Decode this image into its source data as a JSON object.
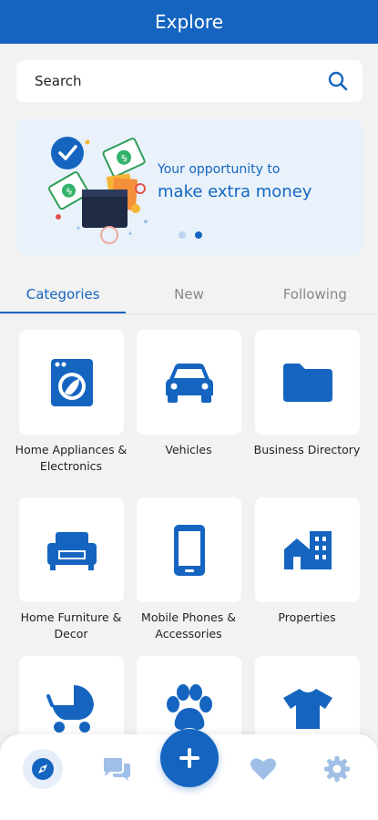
{
  "header": {
    "title": "Explore"
  },
  "search": {
    "placeholder": "Search"
  },
  "banner": {
    "line1": "Your opportunity to",
    "line2": "make extra money"
  },
  "tabs": [
    {
      "label": "Categories",
      "active": true
    },
    {
      "label": "New",
      "active": false
    },
    {
      "label": "Following",
      "active": false
    }
  ],
  "categories": [
    {
      "label": "Home Appliances & Electronics",
      "icon": "washing-machine-icon"
    },
    {
      "label": "Vehicles",
      "icon": "car-icon"
    },
    {
      "label": "Business Directory",
      "icon": "folder-icon"
    },
    {
      "label": "Home Furniture & Decor",
      "icon": "sofa-icon"
    },
    {
      "label": "Mobile Phones & Accessories",
      "icon": "smartphone-icon"
    },
    {
      "label": "Properties",
      "icon": "buildings-icon"
    },
    {
      "label": "",
      "icon": "stroller-icon"
    },
    {
      "label": "",
      "icon": "paw-icon"
    },
    {
      "label": "",
      "icon": "tshirt-icon"
    }
  ],
  "bottom_nav": [
    {
      "name": "explore",
      "icon": "compass-icon",
      "active": true
    },
    {
      "name": "messages",
      "icon": "chat-icon",
      "active": false
    },
    {
      "name": "add",
      "icon": "plus-icon",
      "active": false
    },
    {
      "name": "favorites",
      "icon": "heart-icon",
      "active": false
    },
    {
      "name": "settings",
      "icon": "gear-icon",
      "active": false
    }
  ],
  "colors": {
    "primary": "#1565c0",
    "icon_light": "#9fbfe6",
    "banner_bg": "#e9f2fb"
  }
}
